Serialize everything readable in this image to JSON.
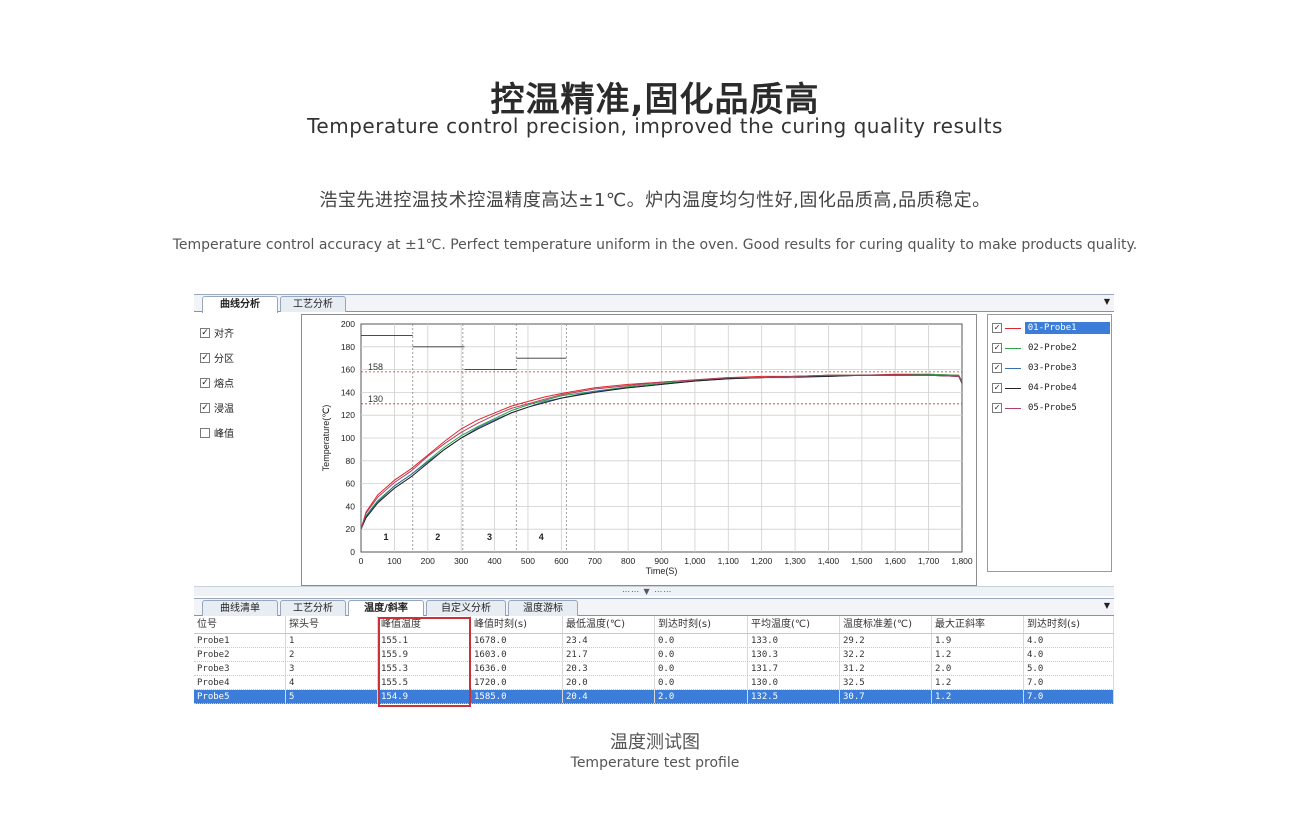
{
  "header": {
    "title": "控温精准,固化品质高",
    "subtitle": "Temperature control precision, improved the curing quality results",
    "desc_cn": "浩宝先进控温技术控温精度高达±1℃。炉内温度均匀性好,固化品质高,品质稳定。",
    "desc_en": "Temperature control accuracy at ±1℃. Perfect temperature uniform in the oven. Good results for curing quality to make products quality."
  },
  "top_tabs": [
    {
      "label": "曲线分析",
      "active": true
    },
    {
      "label": "工艺分析",
      "active": false
    }
  ],
  "options": [
    {
      "label": "对齐",
      "checked": true
    },
    {
      "label": "分区",
      "checked": true
    },
    {
      "label": "熔点",
      "checked": true
    },
    {
      "label": "浸温",
      "checked": true
    },
    {
      "label": "峰值",
      "checked": false
    }
  ],
  "chart_data": {
    "type": "line",
    "xlabel": "Time(S)",
    "ylabel": "Temperature(℃)",
    "xlim": [
      0,
      1800
    ],
    "ylim": [
      0,
      200
    ],
    "x_ticks": [
      "0",
      "100",
      "200",
      "300",
      "400",
      "500",
      "600",
      "700",
      "800",
      "900",
      "1,000",
      "1,100",
      "1,200",
      "1,300",
      "1,400",
      "1,500",
      "1,600",
      "1,700",
      "1,800"
    ],
    "y_ticks": [
      "0",
      "20",
      "40",
      "60",
      "80",
      "100",
      "120",
      "140",
      "160",
      "180",
      "200"
    ],
    "grid": true,
    "reference_lines": [
      {
        "label": "158",
        "y": 158,
        "color": "#c0392b"
      },
      {
        "label": "130",
        "y": 130,
        "color": "#c0392b"
      }
    ],
    "zone_boundaries": [
      155,
      305,
      465,
      615
    ],
    "zones": [
      {
        "label": "1",
        "x": 75
      },
      {
        "label": "2",
        "x": 230
      },
      {
        "label": "3",
        "x": 385
      },
      {
        "label": "4",
        "x": 540
      }
    ],
    "setpoint_segments": [
      {
        "x0": 0,
        "x1": 155,
        "y": 190
      },
      {
        "x0": 155,
        "x1": 310,
        "y": 180
      },
      {
        "x0": 310,
        "x1": 465,
        "y": 160
      },
      {
        "x0": 465,
        "x1": 615,
        "y": 170
      }
    ],
    "x": [
      0,
      15,
      50,
      100,
      150,
      200,
      250,
      300,
      350,
      400,
      450,
      500,
      550,
      600,
      700,
      800,
      900,
      1000,
      1100,
      1200,
      1300,
      1400,
      1500,
      1600,
      1700,
      1790,
      1800
    ],
    "series": [
      {
        "name": "01-Probe1",
        "color": "#e0262b",
        "values": [
          20,
          35,
          50,
          63,
          73,
          85,
          97,
          108,
          116,
          122,
          128,
          132,
          136,
          139,
          144,
          147,
          149,
          151,
          153,
          154,
          154,
          155,
          155,
          156,
          156,
          155,
          149
        ]
      },
      {
        "name": "02-Probe2",
        "color": "#2aa34a",
        "values": [
          20,
          32,
          45,
          58,
          68,
          80,
          92,
          102,
          110,
          117,
          124,
          129,
          133,
          137,
          141,
          145,
          148,
          150,
          152,
          153,
          154,
          155,
          155,
          155,
          156,
          155,
          150
        ]
      },
      {
        "name": "03-Probe3",
        "color": "#3a6fb0",
        "values": [
          20,
          31,
          44,
          58,
          68,
          79,
          90,
          100,
          109,
          116,
          122,
          127,
          132,
          135,
          141,
          144,
          147,
          150,
          152,
          153,
          153,
          154,
          155,
          155,
          155,
          154,
          149
        ]
      },
      {
        "name": "04-Probe4",
        "color": "#222222",
        "values": [
          20,
          30,
          43,
          56,
          66,
          78,
          90,
          100,
          108,
          115,
          122,
          127,
          131,
          135,
          140,
          144,
          147,
          150,
          152,
          153,
          154,
          154,
          155,
          155,
          155,
          154,
          148
        ]
      },
      {
        "name": "05-Probe5",
        "color": "#b04060",
        "values": [
          20,
          34,
          48,
          61,
          71,
          84,
          95,
          105,
          113,
          120,
          126,
          130,
          134,
          138,
          143,
          146,
          149,
          151,
          153,
          153,
          154,
          155,
          155,
          155,
          155,
          154,
          149
        ]
      }
    ]
  },
  "legend": {
    "selected_index": 0
  },
  "bottom_tabs": [
    {
      "label": "曲线清单",
      "active": false
    },
    {
      "label": "工艺分析",
      "active": false
    },
    {
      "label": "温度/斜率",
      "active": true
    },
    {
      "label": "自定义分析",
      "active": false
    },
    {
      "label": "温度游标",
      "active": false
    }
  ],
  "table": {
    "columns": [
      "位号",
      "探头号",
      "峰值温度",
      "峰值时刻(s)",
      "最低温度(℃)",
      "到达时刻(s)",
      "平均温度(℃)",
      "温度标准差(℃)",
      "最大正斜率",
      "到达时刻(s)"
    ],
    "rows": [
      [
        "Probe1",
        "1",
        "155.1",
        "1678.0",
        "23.4",
        "0.0",
        "133.0",
        "29.2",
        "1.9",
        "4.0"
      ],
      [
        "Probe2",
        "2",
        "155.9",
        "1603.0",
        "21.7",
        "0.0",
        "130.3",
        "32.2",
        "1.2",
        "4.0"
      ],
      [
        "Probe3",
        "3",
        "155.3",
        "1636.0",
        "20.3",
        "0.0",
        "131.7",
        "31.2",
        "2.0",
        "5.0"
      ],
      [
        "Probe4",
        "4",
        "155.5",
        "1720.0",
        "20.0",
        "0.0",
        "130.0",
        "32.5",
        "1.2",
        "7.0"
      ],
      [
        "Probe5",
        "5",
        "154.9",
        "1585.0",
        "20.4",
        "2.0",
        "132.5",
        "30.7",
        "1.2",
        "7.0"
      ]
    ],
    "selected_row": 4
  },
  "caption": {
    "cn": "温度测试图",
    "en": "Temperature test profile"
  }
}
